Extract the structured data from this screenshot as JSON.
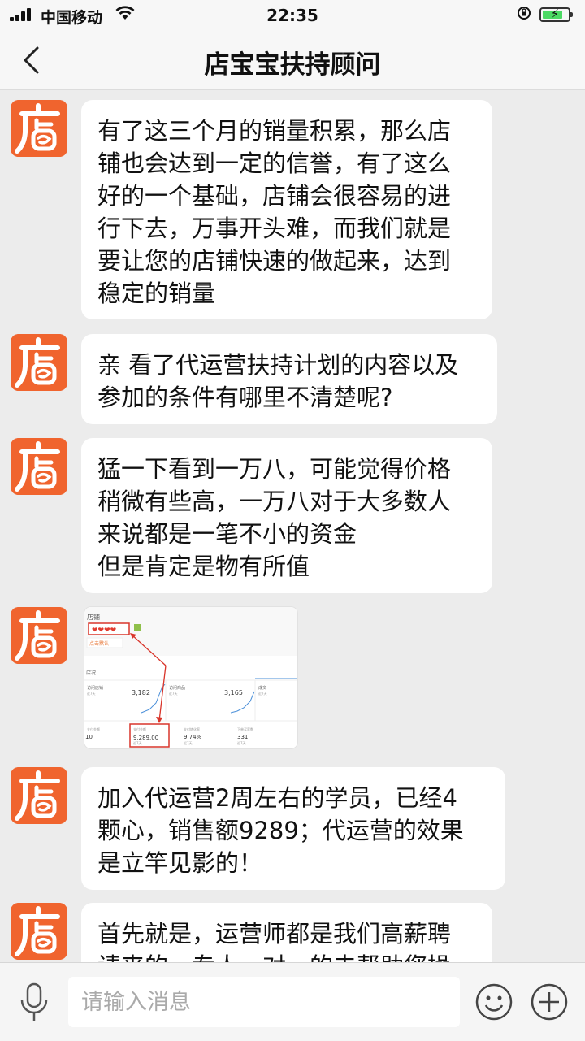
{
  "status_bar": {
    "carrier": "中国移动",
    "time": "22:35",
    "wifi_icon": "wifi-icon",
    "battery_level": 0.72
  },
  "nav": {
    "title": "店宝宝扶持顾问",
    "back_icon": "chevron-left-icon"
  },
  "avatar": {
    "glyph": "店",
    "color": "#f0642e"
  },
  "messages": [
    {
      "type": "text",
      "text": "有了这三个月的销量积累，那么店\n铺也会达到一定的信誉，有了这么\n好的一个基础，店铺会很容易的进\n行下去，万事开头难，而我们就是\n要让您的店铺快速的做起来，达到\n稳定的销量"
    },
    {
      "type": "text",
      "text": "亲 看了代运营扶持计划的内容以及\n参加的条件有哪里不清楚呢?"
    },
    {
      "type": "text",
      "text": "猛一下看到一万八，可能觉得价格\n稍微有些高，一万八对于大多数人\n来说都是一笔不小的资金\n但是肯定是物有所值"
    },
    {
      "type": "image",
      "screenshot": {
        "shop_label": "店铺",
        "hearts": "❤❤❤❤",
        "badge": "点击默认",
        "section": "店况",
        "stats": [
          {
            "label": "访问店铺",
            "sub": "近7天",
            "value": "3,182"
          },
          {
            "label": "访问商品",
            "sub": "近7天",
            "value": "3,165"
          },
          {
            "label": "成交",
            "sub": "近7天",
            "value": ""
          }
        ],
        "bottom": [
          {
            "label": "支付金额",
            "value": "10"
          },
          {
            "label": "支付金额",
            "sub": "近7天",
            "value": "9,289.00"
          },
          {
            "label": "支付转化率",
            "sub": "近7天",
            "value": "9.74%"
          },
          {
            "label": "下单买家数",
            "sub": "近7天",
            "value": "331"
          }
        ]
      }
    },
    {
      "type": "text",
      "text": "加入代运营2周左右的学员，已经4\n颗心，销售额9289；代运营的效果\n是立竿见影的！"
    },
    {
      "type": "text",
      "text": "首先就是，运营师都是我们高薪聘\n请来的，专人一对一的去帮助您操"
    }
  ],
  "input_bar": {
    "placeholder": "请输入消息",
    "value": "",
    "mic_icon": "microphone-icon",
    "emoji_icon": "smiley-icon",
    "plus_icon": "plus-circle-icon"
  }
}
